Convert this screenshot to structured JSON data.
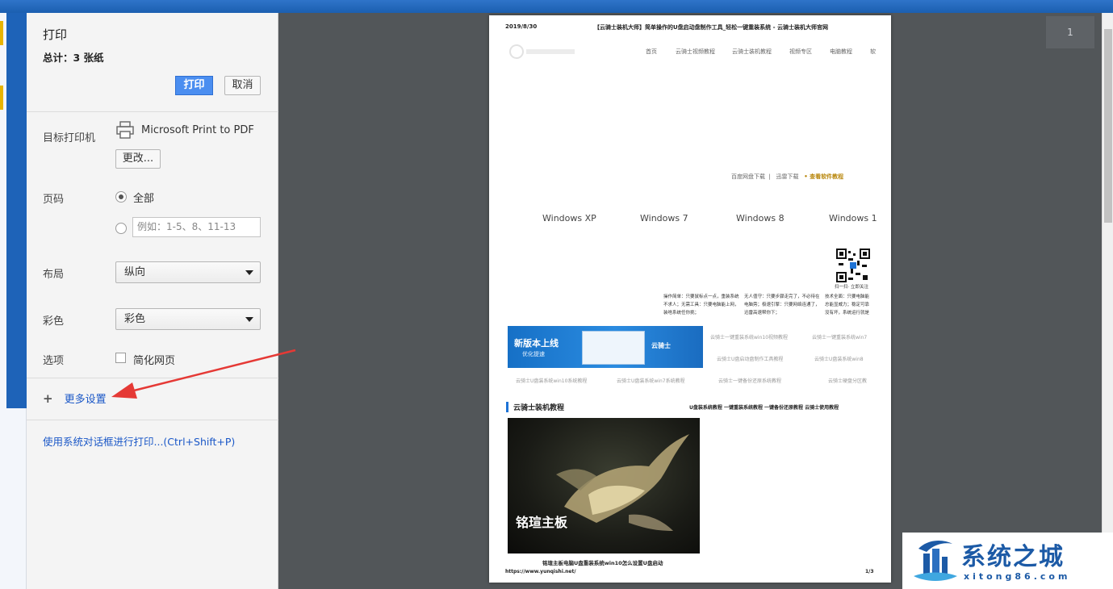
{
  "sidebar": {
    "title": "打印",
    "total": "总计：3 张纸",
    "print_label": "打印",
    "cancel_label": "取消",
    "destination_label": "目标打印机",
    "printer_name": "Microsoft Print to PDF",
    "change_label": "更改...",
    "pages_label": "页码",
    "pages_all": "全部",
    "pages_placeholder": "例如：1-5、8、11-13",
    "layout_label": "布局",
    "layout_value": "纵向",
    "color_label": "彩色",
    "color_value": "彩色",
    "options_label": "选项",
    "simplify_label": "简化网页",
    "more_settings_label": "更多设置",
    "system_dialog_label": "使用系统对话框进行打印...(Ctrl+Shift+P)"
  },
  "preview": {
    "page_number": "1",
    "date": "2019/8/30",
    "header_title": "【云骑士装机大师】简单操作的U盘启动盘制作工具_轻松一键重装系统 - 云骑士装机大师官网",
    "nav": [
      "首页",
      "云骑士视频教程",
      "云骑士装机教程",
      "视频专区",
      "电脑教程",
      "软"
    ],
    "links": [
      "百度网盘下载",
      "迅雷下载"
    ],
    "links_highlight": "• 查看软件教程",
    "windows": [
      "Windows XP",
      "Windows 7",
      "Windows 8",
      "Windows 1"
    ],
    "qr_caption": "扫一扫· 立即关注",
    "features": [
      "操作简单：只要鼠标点一点，重装系统不求人；无需工具：只要电脑能上网，装啥系统任你挑；",
      "无人值守：只要步骤走完了，不必待在电脑旁；极速引擎：只要网络连通了，迅雷高速帮你下；",
      "技术全面：只要电脑能总能显威力；稳定可靠没有坏，系统运行就是"
    ],
    "banner_title": "新版本上线",
    "banner_sub": "优化提速",
    "banner_brand": "云骑士",
    "small_links": [
      "云骑士一键重装系统win10视频教程",
      "云骑士一键重装系统win7",
      "云骑士U盘启动盘制作工具教程",
      "云骑士U盘装系统win8",
      "云骑士U盘装系统win10系统教程",
      "云骑士U盘装系统win7系统教程",
      "云骑士一键备份还原系统教程",
      "云骑士硬盘分区教"
    ],
    "section_title": "云骑士装机教程",
    "section_links": "U盘装系统教程 一键重装系统教程 一键备份还原教程 云骑士使用教程",
    "image_caption": "铭瑄主板",
    "image_text": "铭瑄主板电脑U盘重装系统win10怎么设置U盘启动",
    "url": "https://www.yunqishi.net/",
    "page_of": "1/3"
  },
  "watermark": {
    "title": "系统之城",
    "sub": "xitong86.com"
  },
  "colors": {
    "accent_blue": "#4b8ef0",
    "link_blue": "#1a57c7",
    "preview_bg": "#525659",
    "arrow_red": "#e53935"
  }
}
